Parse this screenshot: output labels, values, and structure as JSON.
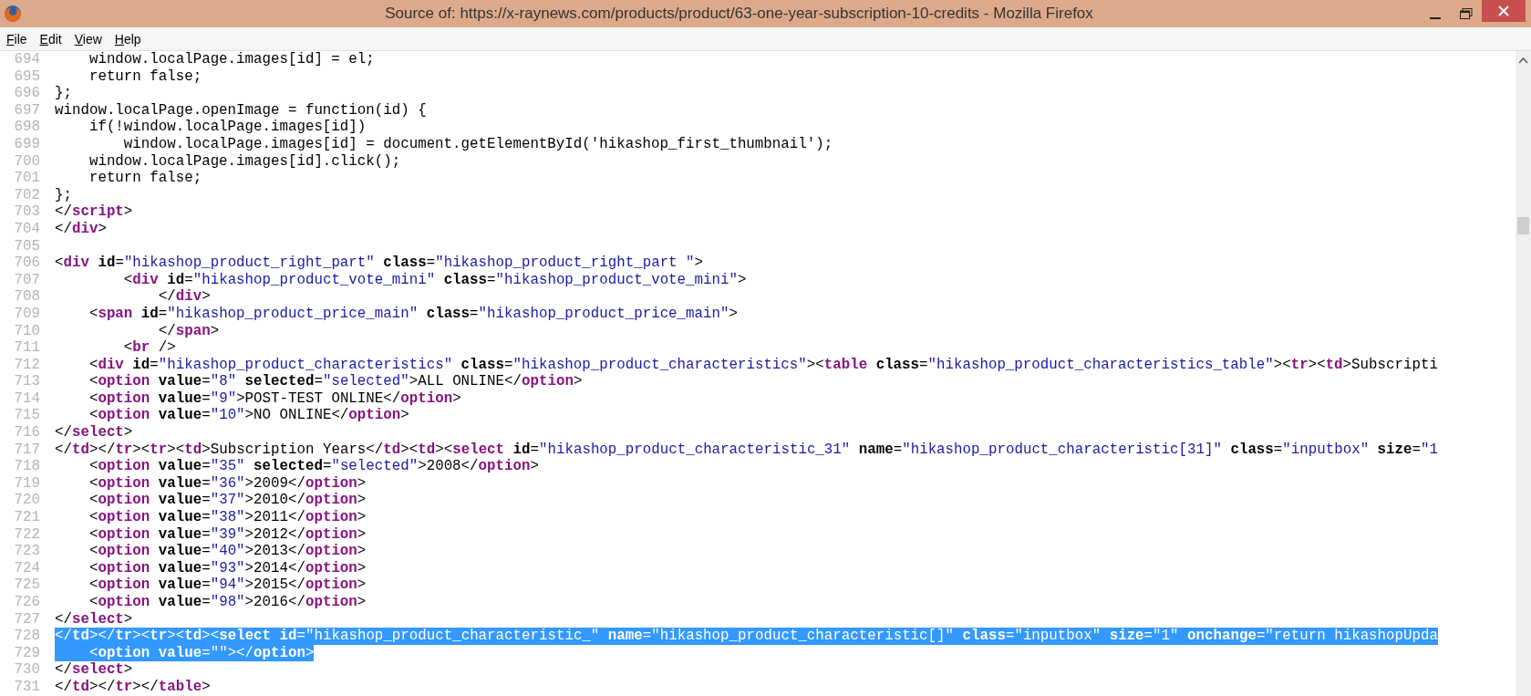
{
  "window": {
    "title": "Source of: https://x-raynews.com/products/product/63-one-year-subscription-10-credits - Mozilla Firefox"
  },
  "menu": [
    "File",
    "Edit",
    "View",
    "Help"
  ],
  "lines": [
    {
      "number": "694",
      "selected": false,
      "tokens": [
        {
          "kind": "text",
          "text": "    window.localPage.images[id] = el;"
        }
      ]
    },
    {
      "number": "695",
      "selected": false,
      "tokens": [
        {
          "kind": "text",
          "text": "    return false;"
        }
      ]
    },
    {
      "number": "696",
      "selected": false,
      "tokens": [
        {
          "kind": "text",
          "text": "};"
        }
      ]
    },
    {
      "number": "697",
      "selected": false,
      "tokens": [
        {
          "kind": "text",
          "text": "window.localPage.openImage = function(id) {"
        }
      ]
    },
    {
      "number": "698",
      "selected": false,
      "tokens": [
        {
          "kind": "text",
          "text": "    if(!window.localPage.images[id])"
        }
      ]
    },
    {
      "number": "699",
      "selected": false,
      "tokens": [
        {
          "kind": "text",
          "text": "        window.localPage.images[id] = document.getElementById('hikashop_first_thumbnail');"
        }
      ]
    },
    {
      "number": "700",
      "selected": false,
      "tokens": [
        {
          "kind": "text",
          "text": "    window.localPage.images[id].click();"
        }
      ]
    },
    {
      "number": "701",
      "selected": false,
      "tokens": [
        {
          "kind": "text",
          "text": "    return false;"
        }
      ]
    },
    {
      "number": "702",
      "selected": false,
      "tokens": [
        {
          "kind": "text",
          "text": "};"
        }
      ]
    },
    {
      "number": "703",
      "selected": false,
      "tokens": [
        {
          "kind": "text",
          "text": "</"
        },
        {
          "kind": "tag",
          "text": "script"
        },
        {
          "kind": "text",
          "text": ">"
        }
      ]
    },
    {
      "number": "704",
      "selected": false,
      "tokens": [
        {
          "kind": "text",
          "text": "</"
        },
        {
          "kind": "tag",
          "text": "div"
        },
        {
          "kind": "text",
          "text": ">"
        }
      ]
    },
    {
      "number": "705",
      "selected": false
    },
    {
      "number": "706",
      "selected": false,
      "tokens": [
        {
          "kind": "text",
          "text": "<"
        },
        {
          "kind": "tag",
          "text": "div"
        },
        {
          "kind": "attr",
          "text": " id"
        },
        {
          "kind": "text",
          "text": "="
        },
        {
          "kind": "value",
          "text": "\"hikashop_product_right_part\""
        },
        {
          "kind": "attr",
          "text": " class"
        },
        {
          "kind": "text",
          "text": "="
        },
        {
          "kind": "value",
          "text": "\"hikashop_product_right_part \""
        },
        {
          "kind": "text",
          "text": ">"
        }
      ]
    },
    {
      "number": "707",
      "selected": false,
      "tokens": [
        {
          "kind": "text",
          "text": "        <"
        },
        {
          "kind": "tag",
          "text": "div"
        },
        {
          "kind": "attr",
          "text": " id"
        },
        {
          "kind": "text",
          "text": "="
        },
        {
          "kind": "value",
          "text": "\"hikashop_product_vote_mini\""
        },
        {
          "kind": "attr",
          "text": " class"
        },
        {
          "kind": "text",
          "text": "="
        },
        {
          "kind": "value",
          "text": "\"hikashop_product_vote_mini\""
        },
        {
          "kind": "text",
          "text": ">"
        }
      ]
    },
    {
      "number": "708",
      "selected": false,
      "tokens": [
        {
          "kind": "text",
          "text": "            </"
        },
        {
          "kind": "tag",
          "text": "div"
        },
        {
          "kind": "text",
          "text": ">"
        }
      ]
    },
    {
      "number": "709",
      "selected": false,
      "tokens": [
        {
          "kind": "text",
          "text": "    <"
        },
        {
          "kind": "tag",
          "text": "span"
        },
        {
          "kind": "attr",
          "text": " id"
        },
        {
          "kind": "text",
          "text": "="
        },
        {
          "kind": "value",
          "text": "\"hikashop_product_price_main\""
        },
        {
          "kind": "attr",
          "text": " class"
        },
        {
          "kind": "text",
          "text": "="
        },
        {
          "kind": "value",
          "text": "\"hikashop_product_price_main\""
        },
        {
          "kind": "text",
          "text": ">"
        }
      ]
    },
    {
      "number": "710",
      "selected": false,
      "tokens": [
        {
          "kind": "text",
          "text": "            </"
        },
        {
          "kind": "tag",
          "text": "span"
        },
        {
          "kind": "text",
          "text": ">"
        }
      ]
    },
    {
      "number": "711",
      "selected": false,
      "tokens": [
        {
          "kind": "text",
          "text": "        <"
        },
        {
          "kind": "tag",
          "text": "br"
        },
        {
          "kind": "text",
          "text": " />"
        }
      ]
    },
    {
      "number": "712",
      "selected": false,
      "tokens": [
        {
          "kind": "text",
          "text": "    <"
        },
        {
          "kind": "tag",
          "text": "div"
        },
        {
          "kind": "attr",
          "text": " id"
        },
        {
          "kind": "text",
          "text": "="
        },
        {
          "kind": "value",
          "text": "\"hikashop_product_characteristics\""
        },
        {
          "kind": "attr",
          "text": " class"
        },
        {
          "kind": "text",
          "text": "="
        },
        {
          "kind": "value",
          "text": "\"hikashop_product_characteristics\""
        },
        {
          "kind": "text",
          "text": "><"
        },
        {
          "kind": "tag",
          "text": "table"
        },
        {
          "kind": "attr",
          "text": " class"
        },
        {
          "kind": "text",
          "text": "="
        },
        {
          "kind": "value",
          "text": "\"hikashop_product_characteristics_table\""
        },
        {
          "kind": "text",
          "text": "><"
        },
        {
          "kind": "tag",
          "text": "tr"
        },
        {
          "kind": "text",
          "text": "><"
        },
        {
          "kind": "tag",
          "text": "td"
        },
        {
          "kind": "text",
          "text": ">Subscripti"
        }
      ]
    },
    {
      "number": "713",
      "selected": false,
      "tokens": [
        {
          "kind": "text",
          "text": "    <"
        },
        {
          "kind": "tag",
          "text": "option"
        },
        {
          "kind": "attr",
          "text": " value"
        },
        {
          "kind": "text",
          "text": "="
        },
        {
          "kind": "value",
          "text": "\"8\""
        },
        {
          "kind": "attr",
          "text": " selected"
        },
        {
          "kind": "text",
          "text": "="
        },
        {
          "kind": "value",
          "text": "\"selected\""
        },
        {
          "kind": "text",
          "text": ">ALL ONLINE</"
        },
        {
          "kind": "tag",
          "text": "option"
        },
        {
          "kind": "text",
          "text": ">"
        }
      ]
    },
    {
      "number": "714",
      "selected": false,
      "tokens": [
        {
          "kind": "text",
          "text": "    <"
        },
        {
          "kind": "tag",
          "text": "option"
        },
        {
          "kind": "attr",
          "text": " value"
        },
        {
          "kind": "text",
          "text": "="
        },
        {
          "kind": "value",
          "text": "\"9\""
        },
        {
          "kind": "text",
          "text": ">POST-TEST ONLINE</"
        },
        {
          "kind": "tag",
          "text": "option"
        },
        {
          "kind": "text",
          "text": ">"
        }
      ]
    },
    {
      "number": "715",
      "selected": false,
      "tokens": [
        {
          "kind": "text",
          "text": "    <"
        },
        {
          "kind": "tag",
          "text": "option"
        },
        {
          "kind": "attr",
          "text": " value"
        },
        {
          "kind": "text",
          "text": "="
        },
        {
          "kind": "value",
          "text": "\"10\""
        },
        {
          "kind": "text",
          "text": ">NO ONLINE</"
        },
        {
          "kind": "tag",
          "text": "option"
        },
        {
          "kind": "text",
          "text": ">"
        }
      ]
    },
    {
      "number": "716",
      "selected": false,
      "tokens": [
        {
          "kind": "text",
          "text": "</"
        },
        {
          "kind": "tag",
          "text": "select"
        },
        {
          "kind": "text",
          "text": ">"
        }
      ]
    },
    {
      "number": "717",
      "selected": false,
      "tokens": [
        {
          "kind": "text",
          "text": "</"
        },
        {
          "kind": "tag",
          "text": "td"
        },
        {
          "kind": "text",
          "text": "></"
        },
        {
          "kind": "tag",
          "text": "tr"
        },
        {
          "kind": "text",
          "text": "><"
        },
        {
          "kind": "tag",
          "text": "tr"
        },
        {
          "kind": "text",
          "text": "><"
        },
        {
          "kind": "tag",
          "text": "td"
        },
        {
          "kind": "text",
          "text": ">Subscription Years</"
        },
        {
          "kind": "tag",
          "text": "td"
        },
        {
          "kind": "text",
          "text": "><"
        },
        {
          "kind": "tag",
          "text": "td"
        },
        {
          "kind": "text",
          "text": "><"
        },
        {
          "kind": "tag",
          "text": "select"
        },
        {
          "kind": "attr",
          "text": " id"
        },
        {
          "kind": "text",
          "text": "="
        },
        {
          "kind": "value",
          "text": "\"hikashop_product_characteristic_31\""
        },
        {
          "kind": "attr",
          "text": " name"
        },
        {
          "kind": "text",
          "text": "="
        },
        {
          "kind": "value",
          "text": "\"hikashop_product_characteristic[31]\""
        },
        {
          "kind": "attr",
          "text": " class"
        },
        {
          "kind": "text",
          "text": "="
        },
        {
          "kind": "value",
          "text": "\"inputbox\""
        },
        {
          "kind": "attr",
          "text": " size"
        },
        {
          "kind": "text",
          "text": "="
        },
        {
          "kind": "value",
          "text": "\"1"
        }
      ]
    },
    {
      "number": "718",
      "selected": false,
      "tokens": [
        {
          "kind": "text",
          "text": "    <"
        },
        {
          "kind": "tag",
          "text": "option"
        },
        {
          "kind": "attr",
          "text": " value"
        },
        {
          "kind": "text",
          "text": "="
        },
        {
          "kind": "value",
          "text": "\"35\""
        },
        {
          "kind": "attr",
          "text": " selected"
        },
        {
          "kind": "text",
          "text": "="
        },
        {
          "kind": "value",
          "text": "\"selected\""
        },
        {
          "kind": "text",
          "text": ">2008</"
        },
        {
          "kind": "tag",
          "text": "option"
        },
        {
          "kind": "text",
          "text": ">"
        }
      ]
    },
    {
      "number": "719",
      "selected": false,
      "tokens": [
        {
          "kind": "text",
          "text": "    <"
        },
        {
          "kind": "tag",
          "text": "option"
        },
        {
          "kind": "attr",
          "text": " value"
        },
        {
          "kind": "text",
          "text": "="
        },
        {
          "kind": "value",
          "text": "\"36\""
        },
        {
          "kind": "text",
          "text": ">2009</"
        },
        {
          "kind": "tag",
          "text": "option"
        },
        {
          "kind": "text",
          "text": ">"
        }
      ]
    },
    {
      "number": "720",
      "selected": false,
      "tokens": [
        {
          "kind": "text",
          "text": "    <"
        },
        {
          "kind": "tag",
          "text": "option"
        },
        {
          "kind": "attr",
          "text": " value"
        },
        {
          "kind": "text",
          "text": "="
        },
        {
          "kind": "value",
          "text": "\"37\""
        },
        {
          "kind": "text",
          "text": ">2010</"
        },
        {
          "kind": "tag",
          "text": "option"
        },
        {
          "kind": "text",
          "text": ">"
        }
      ]
    },
    {
      "number": "721",
      "selected": false,
      "tokens": [
        {
          "kind": "text",
          "text": "    <"
        },
        {
          "kind": "tag",
          "text": "option"
        },
        {
          "kind": "attr",
          "text": " value"
        },
        {
          "kind": "text",
          "text": "="
        },
        {
          "kind": "value",
          "text": "\"38\""
        },
        {
          "kind": "text",
          "text": ">2011</"
        },
        {
          "kind": "tag",
          "text": "option"
        },
        {
          "kind": "text",
          "text": ">"
        }
      ]
    },
    {
      "number": "722",
      "selected": false,
      "tokens": [
        {
          "kind": "text",
          "text": "    <"
        },
        {
          "kind": "tag",
          "text": "option"
        },
        {
          "kind": "attr",
          "text": " value"
        },
        {
          "kind": "text",
          "text": "="
        },
        {
          "kind": "value",
          "text": "\"39\""
        },
        {
          "kind": "text",
          "text": ">2012</"
        },
        {
          "kind": "tag",
          "text": "option"
        },
        {
          "kind": "text",
          "text": ">"
        }
      ]
    },
    {
      "number": "723",
      "selected": false,
      "tokens": [
        {
          "kind": "text",
          "text": "    <"
        },
        {
          "kind": "tag",
          "text": "option"
        },
        {
          "kind": "attr",
          "text": " value"
        },
        {
          "kind": "text",
          "text": "="
        },
        {
          "kind": "value",
          "text": "\"40\""
        },
        {
          "kind": "text",
          "text": ">2013</"
        },
        {
          "kind": "tag",
          "text": "option"
        },
        {
          "kind": "text",
          "text": ">"
        }
      ]
    },
    {
      "number": "724",
      "selected": false,
      "tokens": [
        {
          "kind": "text",
          "text": "    <"
        },
        {
          "kind": "tag",
          "text": "option"
        },
        {
          "kind": "attr",
          "text": " value"
        },
        {
          "kind": "text",
          "text": "="
        },
        {
          "kind": "value",
          "text": "\"93\""
        },
        {
          "kind": "text",
          "text": ">2014</"
        },
        {
          "kind": "tag",
          "text": "option"
        },
        {
          "kind": "text",
          "text": ">"
        }
      ]
    },
    {
      "number": "725",
      "selected": false,
      "tokens": [
        {
          "kind": "text",
          "text": "    <"
        },
        {
          "kind": "tag",
          "text": "option"
        },
        {
          "kind": "attr",
          "text": " value"
        },
        {
          "kind": "text",
          "text": "="
        },
        {
          "kind": "value",
          "text": "\"94\""
        },
        {
          "kind": "text",
          "text": ">2015</"
        },
        {
          "kind": "tag",
          "text": "option"
        },
        {
          "kind": "text",
          "text": ">"
        }
      ]
    },
    {
      "number": "726",
      "selected": false,
      "tokens": [
        {
          "kind": "text",
          "text": "    <"
        },
        {
          "kind": "tag",
          "text": "option"
        },
        {
          "kind": "attr",
          "text": " value"
        },
        {
          "kind": "text",
          "text": "="
        },
        {
          "kind": "value",
          "text": "\"98\""
        },
        {
          "kind": "text",
          "text": ">2016</"
        },
        {
          "kind": "tag",
          "text": "option"
        },
        {
          "kind": "text",
          "text": ">"
        }
      ]
    },
    {
      "number": "727",
      "selected": false,
      "tokens": [
        {
          "kind": "text",
          "text": "</"
        },
        {
          "kind": "tag",
          "text": "select"
        },
        {
          "kind": "text",
          "text": ">"
        }
      ]
    },
    {
      "number": "728",
      "selected": true,
      "tokens": [
        {
          "kind": "text",
          "text": "</"
        },
        {
          "kind": "tag",
          "text": "td"
        },
        {
          "kind": "text",
          "text": "></"
        },
        {
          "kind": "tag",
          "text": "tr"
        },
        {
          "kind": "text",
          "text": "><"
        },
        {
          "kind": "tag",
          "text": "tr"
        },
        {
          "kind": "text",
          "text": "><"
        },
        {
          "kind": "tag",
          "text": "td"
        },
        {
          "kind": "text",
          "text": "><"
        },
        {
          "kind": "tag",
          "text": "select"
        },
        {
          "kind": "attr",
          "text": " id"
        },
        {
          "kind": "text",
          "text": "="
        },
        {
          "kind": "value",
          "text": "\"hikashop_product_characteristic_\""
        },
        {
          "kind": "attr",
          "text": " name"
        },
        {
          "kind": "text",
          "text": "="
        },
        {
          "kind": "value",
          "text": "\"hikashop_product_characteristic[]\""
        },
        {
          "kind": "attr",
          "text": " class"
        },
        {
          "kind": "text",
          "text": "="
        },
        {
          "kind": "value",
          "text": "\"inputbox\""
        },
        {
          "kind": "attr",
          "text": " size"
        },
        {
          "kind": "text",
          "text": "="
        },
        {
          "kind": "value",
          "text": "\"1\""
        },
        {
          "kind": "attr",
          "text": " onchange"
        },
        {
          "kind": "text",
          "text": "="
        },
        {
          "kind": "value",
          "text": "\"return hikashopUpda"
        }
      ]
    },
    {
      "number": "729",
      "selected": true,
      "tokens": [
        {
          "kind": "text",
          "text": "    <"
        },
        {
          "kind": "tag",
          "text": "option"
        },
        {
          "kind": "attr",
          "text": " value"
        },
        {
          "kind": "text",
          "text": "="
        },
        {
          "kind": "value",
          "text": "\"\""
        },
        {
          "kind": "text",
          "text": "></"
        },
        {
          "kind": "tag",
          "text": "option"
        },
        {
          "kind": "text",
          "text": ">"
        }
      ]
    },
    {
      "number": "730",
      "selected": false,
      "tokens": [
        {
          "kind": "text",
          "text": "</"
        },
        {
          "kind": "tag",
          "text": "select"
        },
        {
          "kind": "text",
          "text": ">"
        }
      ]
    },
    {
      "number": "731",
      "selected": false,
      "tokens": [
        {
          "kind": "text",
          "text": "</"
        },
        {
          "kind": "tag",
          "text": "td"
        },
        {
          "kind": "text",
          "text": "></"
        },
        {
          "kind": "tag",
          "text": "tr"
        },
        {
          "kind": "text",
          "text": "></"
        },
        {
          "kind": "tag",
          "text": "table"
        },
        {
          "kind": "text",
          "text": ">"
        }
      ]
    }
  ]
}
